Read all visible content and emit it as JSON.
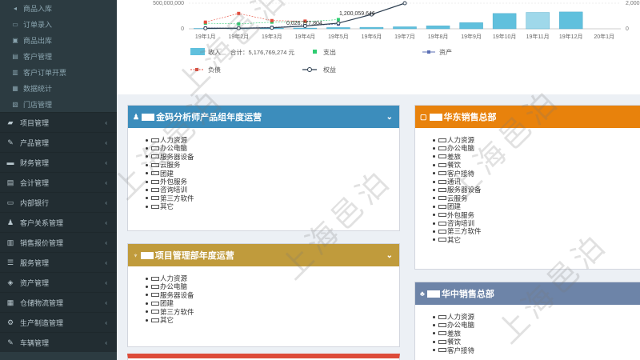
{
  "sidebar": {
    "sub_items": [
      {
        "label": "商品入库",
        "icon": "volume-icon"
      },
      {
        "label": "订单录入",
        "icon": "bookmark-icon"
      },
      {
        "label": "商品出库",
        "icon": "box-icon"
      },
      {
        "label": "客户管理",
        "icon": "card-icon"
      },
      {
        "label": "客户订单开票",
        "icon": "invoice-icon"
      },
      {
        "label": "数据统计",
        "icon": "stats-icon"
      },
      {
        "label": "门店管理",
        "icon": "store-icon"
      }
    ],
    "main_items": [
      {
        "label": "项目管理",
        "icon": "folder-icon"
      },
      {
        "label": "产品管理",
        "icon": "edit-icon"
      },
      {
        "label": "财务管理",
        "icon": "finance-icon"
      },
      {
        "label": "会计管理",
        "icon": "accounting-icon"
      },
      {
        "label": "内部银行",
        "icon": "bank-icon"
      },
      {
        "label": "客户关系管理",
        "icon": "people-icon"
      },
      {
        "label": "销售报价管理",
        "icon": "quote-icon"
      },
      {
        "label": "服务管理",
        "icon": "service-icon"
      },
      {
        "label": "资产管理",
        "icon": "asset-icon"
      },
      {
        "label": "仓储物流管理",
        "icon": "warehouse-icon"
      },
      {
        "label": "生产制造管理",
        "icon": "factory-icon"
      },
      {
        "label": "车辆管理",
        "icon": "car-icon"
      }
    ]
  },
  "chart_data": {
    "type": "bar",
    "categories": [
      "19年1月",
      "19年2月",
      "19年3月",
      "19年4月",
      "19年5月",
      "19年6月",
      "19年7月",
      "19年8月",
      "19年9月",
      "19年10月",
      "19年11月",
      "19年12月",
      "20年1月"
    ],
    "y_tick_top": "500,000,000",
    "y_tick_zero": "0",
    "y2_tick_top": "2,000",
    "y2_tick_zero": "0",
    "ylim": [
      0,
      500000000
    ],
    "series": [
      {
        "name": "收入",
        "type": "bar",
        "color": "#60c0dd",
        "values": [
          8000000,
          3000000,
          12000000,
          15000000,
          25000000,
          30000000,
          40000000,
          60000000,
          120000000,
          300000000,
          320000000,
          330000000,
          0
        ]
      },
      {
        "name": "支出",
        "type": "line",
        "color": "#2ecc71",
        "values": [
          110000000,
          95000000,
          130000000,
          140000000,
          180000000,
          null,
          null,
          null,
          null,
          null,
          null,
          null,
          null
        ]
      },
      {
        "name": "资产",
        "type": "line",
        "color": "#5b6fb5",
        "values": [
          20000000,
          15000000,
          30000000,
          60000000,
          90000000,
          null,
          null,
          null,
          null,
          null,
          null,
          null,
          null
        ]
      },
      {
        "name": "负债",
        "type": "line",
        "color": "#e74c3c",
        "values": [
          130000000,
          300000000,
          160000000,
          150000000,
          null,
          null,
          null,
          null,
          null,
          null,
          null,
          null,
          null
        ]
      },
      {
        "name": "权益",
        "type": "line",
        "color": "#2c3e50",
        "values": [
          10000000,
          12000000,
          20000000,
          55000000,
          110000000,
          280000000,
          500000000,
          null,
          null,
          null,
          null,
          null,
          null
        ]
      }
    ],
    "legend_total_label": "合计：5,176,769,274 元",
    "annotations": [
      "1,200,059,646",
      "0,026,777,804"
    ],
    "highlight_index": 10
  },
  "boxes": [
    {
      "title": "金码分析师产品组年度运营",
      "color": "#3c8dbc",
      "items": [
        "人力资源",
        "办公电脑",
        "服务器设备",
        "云服务",
        "团建",
        "外包服务",
        "咨询培训",
        "第三方软件",
        "其它"
      ]
    },
    {
      "title": "项目管理部年度运营",
      "color": "#c09b3c",
      "items": [
        "人力资源",
        "办公电脑",
        "服务器设备",
        "团建",
        "第三方软件",
        "其它"
      ]
    },
    {
      "title": "华东销售总部",
      "color": "#e8820c",
      "items": [
        "人力资源",
        "办公电脑",
        "差旅",
        "餐饮",
        "客户接待",
        "通讯",
        "服务器设备",
        "云服务",
        "团建",
        "外包服务",
        "咨询培训",
        "第三方软件",
        "其它"
      ]
    },
    {
      "title": "华中销售总部",
      "color": "#6d84a8",
      "items": [
        "人力资源",
        "办公电脑",
        "差旅",
        "餐饮",
        "客户接待"
      ]
    }
  ],
  "watermark": "上海邑泊"
}
